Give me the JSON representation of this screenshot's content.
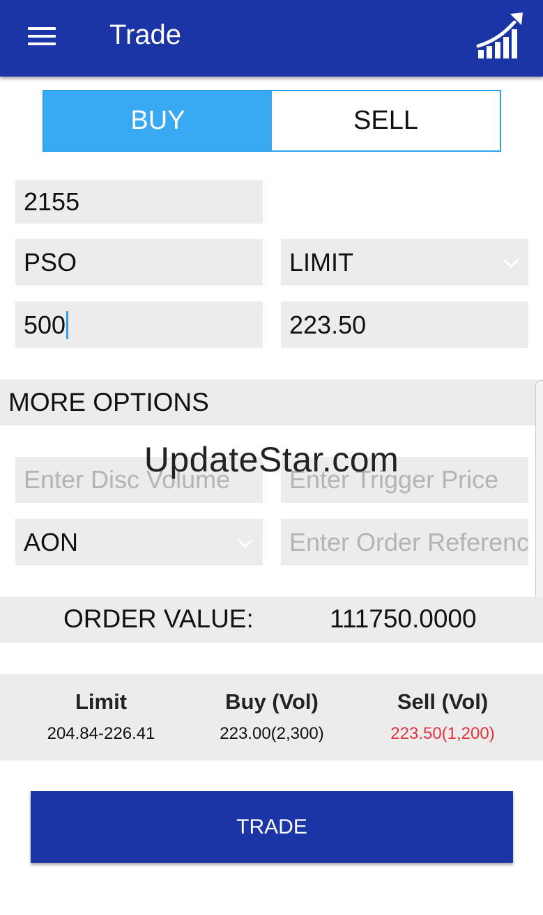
{
  "header": {
    "title": "Trade",
    "menu_icon": "hamburger-menu-icon",
    "logo_icon": "trending-up-chart-icon"
  },
  "side_toggle": {
    "buy_label": "BUY",
    "sell_label": "SELL",
    "selected": "BUY",
    "selected_color": "#39a9f4"
  },
  "form": {
    "account": "2155",
    "symbol": "PSO",
    "order_type": "LIMIT",
    "quantity": "500",
    "price": "223.50"
  },
  "more_options": {
    "label": "MORE OPTIONS",
    "disc_volume_placeholder": "Enter Disc Volume",
    "trigger_price_placeholder": "Enter Trigger Price",
    "duration": "AON",
    "order_reference_placeholder": "Enter Order Reference"
  },
  "order": {
    "label": "ORDER VALUE:",
    "value": "111750.0000"
  },
  "quotes": {
    "limit_label": "Limit",
    "limit_value": "204.84-226.41",
    "buy_label": "Buy (Vol)",
    "buy_value": "223.00(2,300)",
    "sell_label": "Sell (Vol)",
    "sell_value": "223.50(1,200)",
    "sell_color": "#e8323c"
  },
  "trade_button": {
    "label": "TRADE"
  },
  "watermark": "UpdateStar.com",
  "colors": {
    "primary": "#1c35a6",
    "accent": "#39a9f4",
    "field_bg": "#ececec"
  }
}
